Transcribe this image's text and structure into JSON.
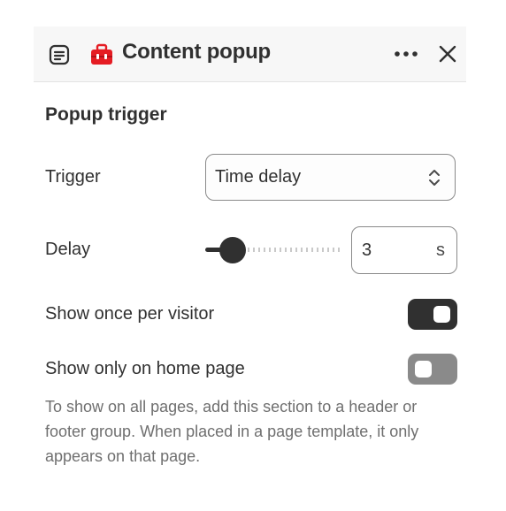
{
  "header": {
    "title": "Content popup",
    "icons": {
      "document": "document-lines-icon",
      "brand": "red-toolbox-icon",
      "more": "more-horizontal-icon",
      "close": "close-icon"
    },
    "brand_color": "#e51c23"
  },
  "section": {
    "title": "Popup trigger"
  },
  "trigger": {
    "label": "Trigger",
    "value": "Time delay"
  },
  "delay": {
    "label": "Delay",
    "value": "3",
    "unit": "s",
    "slider_fraction": 0.13
  },
  "show_once": {
    "label": "Show once per visitor",
    "enabled": true
  },
  "home_only": {
    "label": "Show only on home page",
    "enabled": false
  },
  "help_text": "To show on all pages, add this section to a header or footer group. When placed in a page template, it only appears on that page.",
  "colors": {
    "text": "#303030",
    "toggle_on": "#303030",
    "toggle_off": "#8a8a8a",
    "help": "#6f6f6f"
  }
}
